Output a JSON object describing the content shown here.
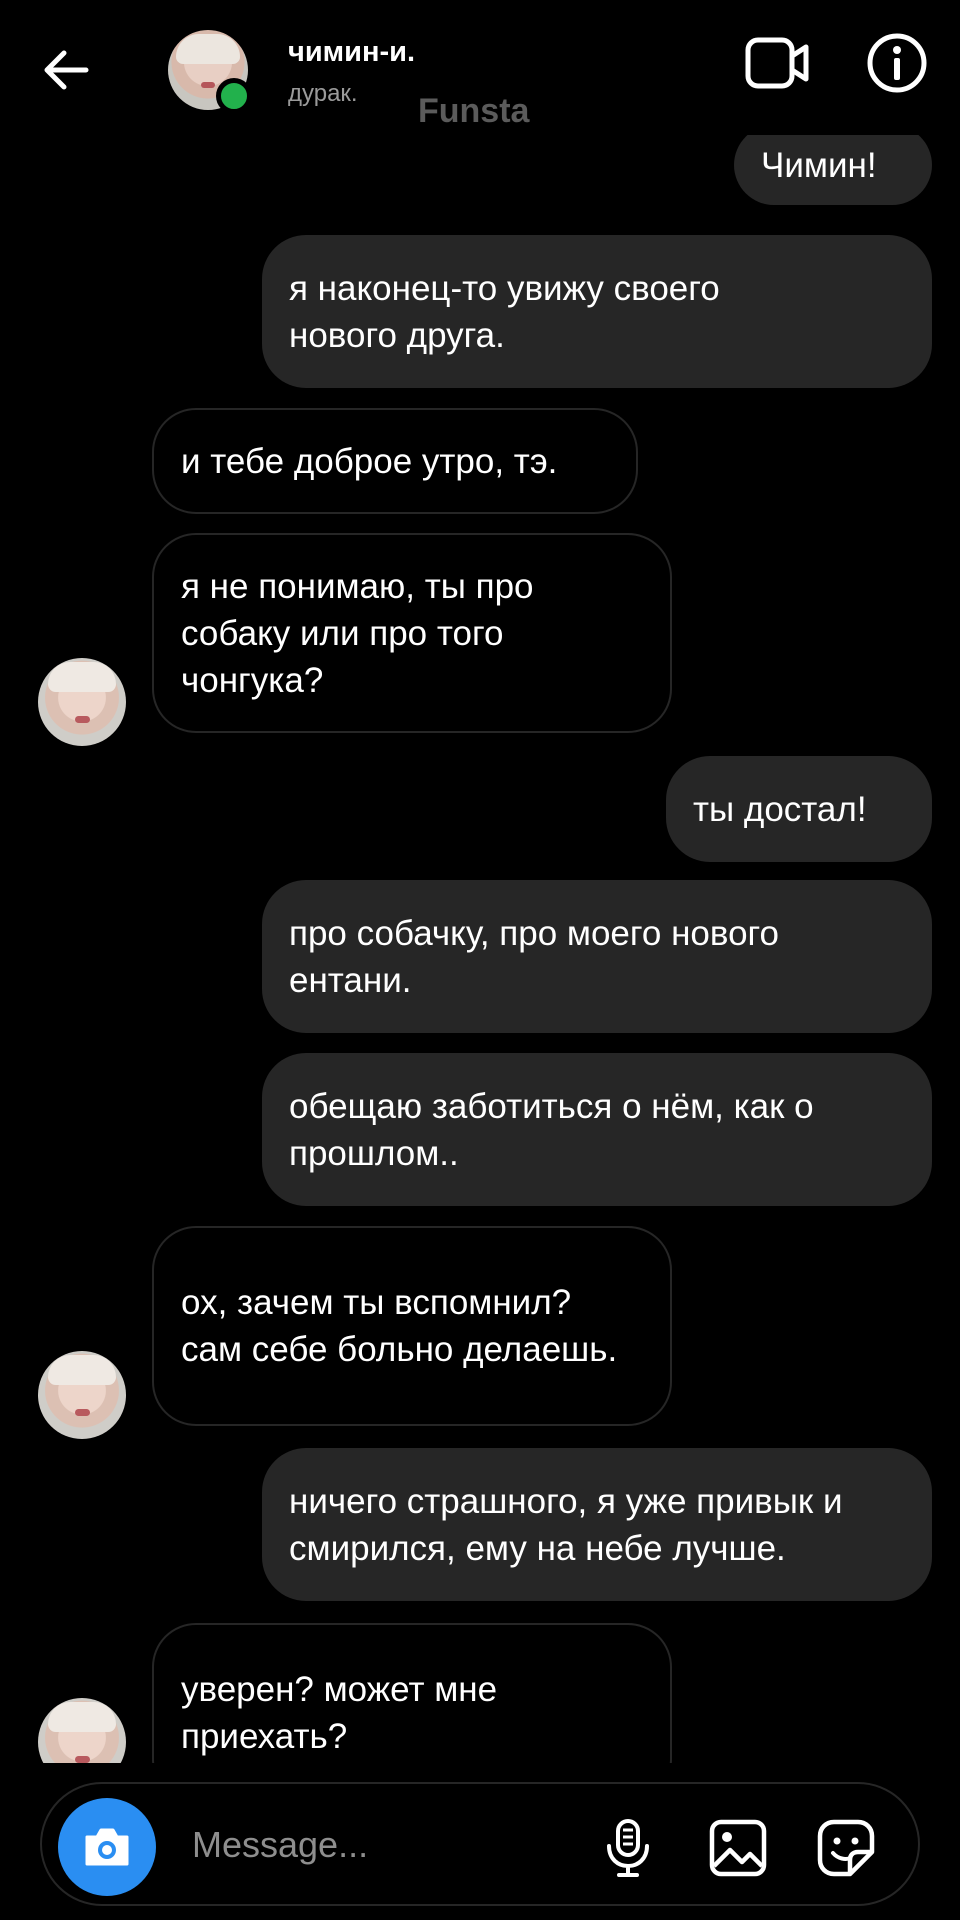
{
  "header": {
    "name": "чимин-и.",
    "status": "дурак.",
    "watermark": "Funsta",
    "icons": {
      "back": "arrow-left-icon",
      "video": "video-camera-icon",
      "info": "info-icon"
    },
    "online_color": "#22b14c"
  },
  "messages": [
    {
      "sender": "me",
      "text": "Чимин!"
    },
    {
      "sender": "me",
      "text": "я наконец-то увижу своего нового друга."
    },
    {
      "sender": "them",
      "text": "и тебе доброе утро, тэ."
    },
    {
      "sender": "them",
      "text": "я не понимаю, ты про собаку или про того чонгука?"
    },
    {
      "sender": "me",
      "text": "ты достал!"
    },
    {
      "sender": "me",
      "text": "про собачку, про моего нового ентани."
    },
    {
      "sender": "me",
      "text": "обещаю заботиться о нём, как о прошлом.."
    },
    {
      "sender": "them",
      "text": "ох, зачем ты вспомнил? сам себе больно делаешь."
    },
    {
      "sender": "me",
      "text": "ничего страшного, я уже привык и смирился, ему на небе лучше."
    },
    {
      "sender": "them",
      "text": "уверен? может мне приехать?"
    }
  ],
  "composer": {
    "placeholder": "Message...",
    "camera_color": "#2a8ef2",
    "icons": [
      "camera-icon",
      "microphone-icon",
      "gallery-icon",
      "sticker-icon"
    ]
  },
  "colors": {
    "background": "#000000",
    "outgoing_bubble": "#262626",
    "incoming_border": "#262626"
  }
}
